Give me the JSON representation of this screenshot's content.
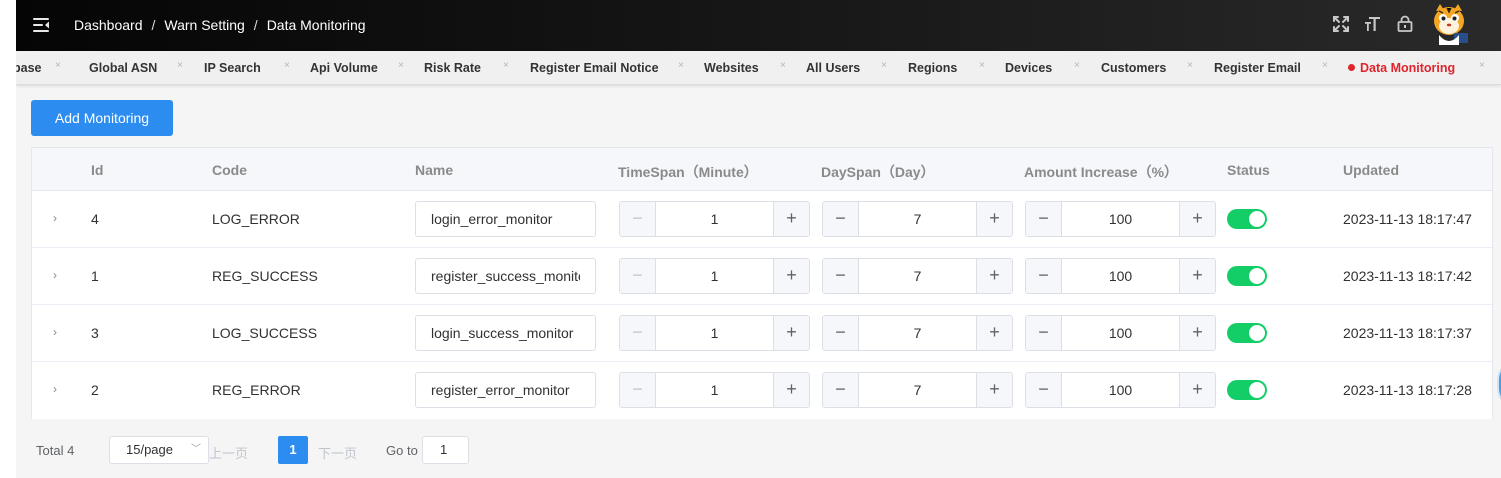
{
  "header": {
    "breadcrumb": [
      "Dashboard",
      "Warn Setting",
      "Data Monitoring"
    ],
    "separator": "/",
    "icons": [
      "menu-toggle-icon",
      "fullscreen-icon",
      "font-size-icon",
      "lock-icon",
      "avatar"
    ]
  },
  "tags": [
    {
      "label": "base",
      "active": false
    },
    {
      "label": "Global ASN",
      "active": false
    },
    {
      "label": "IP Search",
      "active": false
    },
    {
      "label": "Api Volume",
      "active": false
    },
    {
      "label": "Risk Rate",
      "active": false
    },
    {
      "label": "Register Email Notice",
      "active": false
    },
    {
      "label": "Websites",
      "active": false
    },
    {
      "label": "All Users",
      "active": false
    },
    {
      "label": "Regions",
      "active": false
    },
    {
      "label": "Devices",
      "active": false
    },
    {
      "label": "Customers",
      "active": false
    },
    {
      "label": "Register Email",
      "active": false
    },
    {
      "label": "Data Monitoring",
      "active": true
    }
  ],
  "tag_close": "×",
  "toolbar": {
    "add_label": "Add Monitoring"
  },
  "table": {
    "headers": {
      "id": "Id",
      "code": "Code",
      "name": "Name",
      "timespan": "TimeSpan（Minute）",
      "dayspan": "DaySpan（Day）",
      "amount": "Amount Increase（%）",
      "status": "Status",
      "updated": "Updated"
    },
    "expand_icon": "›",
    "minus": "−",
    "plus": "+",
    "rows": [
      {
        "id": "4",
        "code": "LOG_ERROR",
        "name": "login_error_monitor",
        "timespan": "1",
        "dayspan": "7",
        "amount": "100",
        "status": true,
        "updated": "2023-11-13 18:17:47"
      },
      {
        "id": "1",
        "code": "REG_SUCCESS",
        "name": "register_success_monitor",
        "timespan": "1",
        "dayspan": "7",
        "amount": "100",
        "status": true,
        "updated": "2023-11-13 18:17:42"
      },
      {
        "id": "3",
        "code": "LOG_SUCCESS",
        "name": "login_success_monitor",
        "timespan": "1",
        "dayspan": "7",
        "amount": "100",
        "status": true,
        "updated": "2023-11-13 18:17:37"
      },
      {
        "id": "2",
        "code": "REG_ERROR",
        "name": "register_error_monitor",
        "timespan": "1",
        "dayspan": "7",
        "amount": "100",
        "status": true,
        "updated": "2023-11-13 18:17:28"
      }
    ]
  },
  "pagination": {
    "total": "Total 4",
    "page_size": "15/page",
    "prev": "上一页",
    "current_page": "1",
    "next": "下一页",
    "goto_label": "Go to",
    "goto_value": "1"
  },
  "colors": {
    "primary": "#2d8cf0",
    "active_tag": "#e0242b",
    "switch_on": "#13ce66"
  }
}
